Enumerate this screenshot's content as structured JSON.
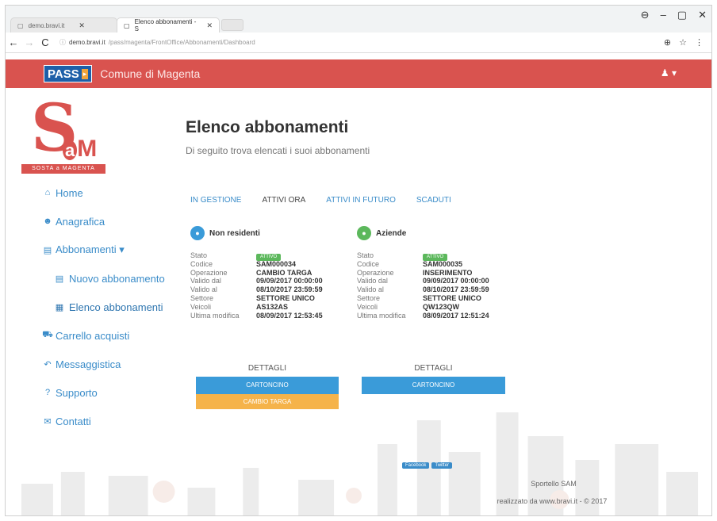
{
  "browser": {
    "tabs": [
      {
        "label": "demo.bravi.it",
        "active": false
      },
      {
        "label": "Elenco abbonamenti - S",
        "active": true
      }
    ],
    "url_host": "demo.bravi.it",
    "url_path": "/pass/magenta/FrontOffice/Abbonamenti/Dashboard",
    "controls": {
      "account": "⊖",
      "minimize": "–",
      "maximize": "▢",
      "close": "✕"
    }
  },
  "header": {
    "logo_text": "PASS",
    "logo_arrow": "▸",
    "title": "Comune di Magenta",
    "user_menu": "♟ ▾"
  },
  "brand": {
    "letter": "S",
    "rest_a": "a",
    "rest_m": "M",
    "tagline": "SOSTA a MAGENTA"
  },
  "sidebar": {
    "items": [
      {
        "icon": "home-icon",
        "glyph": "⌂",
        "label": "Home",
        "level": 0
      },
      {
        "icon": "users-icon",
        "glyph": "☻",
        "label": "Anagrafica",
        "level": 0
      },
      {
        "icon": "card-icon",
        "glyph": "▤",
        "label": "Abbonamenti ▾",
        "level": 0
      },
      {
        "icon": "new-card-icon",
        "glyph": "▤",
        "label": "Nuovo abbonamento",
        "level": 2
      },
      {
        "icon": "list-icon",
        "glyph": "▦",
        "label": "Elenco abbonamenti",
        "level": 2
      },
      {
        "icon": "cart-icon",
        "glyph": "⛟",
        "label": "Carrello acquisti",
        "level": 0
      },
      {
        "icon": "reply-icon",
        "glyph": "↶",
        "label": "Messaggistica",
        "level": 0
      },
      {
        "icon": "question-icon",
        "glyph": "?",
        "label": "Supporto",
        "level": 0
      },
      {
        "icon": "envelope-icon",
        "glyph": "✉",
        "label": "Contatti",
        "level": 0
      }
    ]
  },
  "main": {
    "title": "Elenco abbonamenti",
    "subtitle": "Di seguito trova elencati i suoi abbonamenti",
    "tabs": [
      {
        "label": "IN GESTIONE",
        "active": false
      },
      {
        "label": "ATTIVI ORA",
        "active": true
      },
      {
        "label": "ATTIVI IN FUTURO",
        "active": false
      },
      {
        "label": "SCADUTI",
        "active": false
      }
    ]
  },
  "cards": [
    {
      "title": "Non residenti",
      "circle_color": "#3a9bd9",
      "rows": [
        {
          "k": "Stato",
          "v": "ATTIVO",
          "pill": true
        },
        {
          "k": "Codice",
          "v": "SAM000034"
        },
        {
          "k": "Operazione",
          "v": "CAMBIO TARGA"
        },
        {
          "k": "Valido dal",
          "v": "09/09/2017 00:00:00"
        },
        {
          "k": "Valido al",
          "v": "08/10/2017 23:59:59"
        },
        {
          "k": "Settore",
          "v": "SETTORE UNICO"
        },
        {
          "k": "Veicoli",
          "v": "AS132AS"
        },
        {
          "k": "Ultima modifica",
          "v": "08/09/2017 12:53:45"
        }
      ],
      "details": "DETTAGLI",
      "primary_button": "CARTONCINO",
      "secondary_button": "CAMBIO TARGA"
    },
    {
      "title": "Aziende",
      "circle_color": "#5cb85c",
      "rows": [
        {
          "k": "Stato",
          "v": "ATTIVO",
          "pill": true
        },
        {
          "k": "Codice",
          "v": "SAM000035"
        },
        {
          "k": "Operazione",
          "v": "INSERIMENTO"
        },
        {
          "k": "Valido dal",
          "v": "09/09/2017 00:00:00"
        },
        {
          "k": "Valido al",
          "v": "08/10/2017 23:59:59"
        },
        {
          "k": "Settore",
          "v": "SETTORE UNICO"
        },
        {
          "k": "Veicoli",
          "v": "QW123QW"
        },
        {
          "k": "Ultima modifica",
          "v": "08/09/2017 12:51:24"
        }
      ],
      "details": "DETTAGLI",
      "primary_button": "CARTONCINO"
    }
  ],
  "footer": {
    "links": [
      "Facebook",
      "Twitter"
    ],
    "name": "Sportello SAM",
    "credit": "realizzato da www.bravi.it - © 2017"
  },
  "colors": {
    "header_red": "#d9534f",
    "link_blue": "#3a8cc9",
    "button_blue": "#3a9bd9",
    "button_orange": "#f5b34a",
    "status_green": "#5cb85c"
  }
}
